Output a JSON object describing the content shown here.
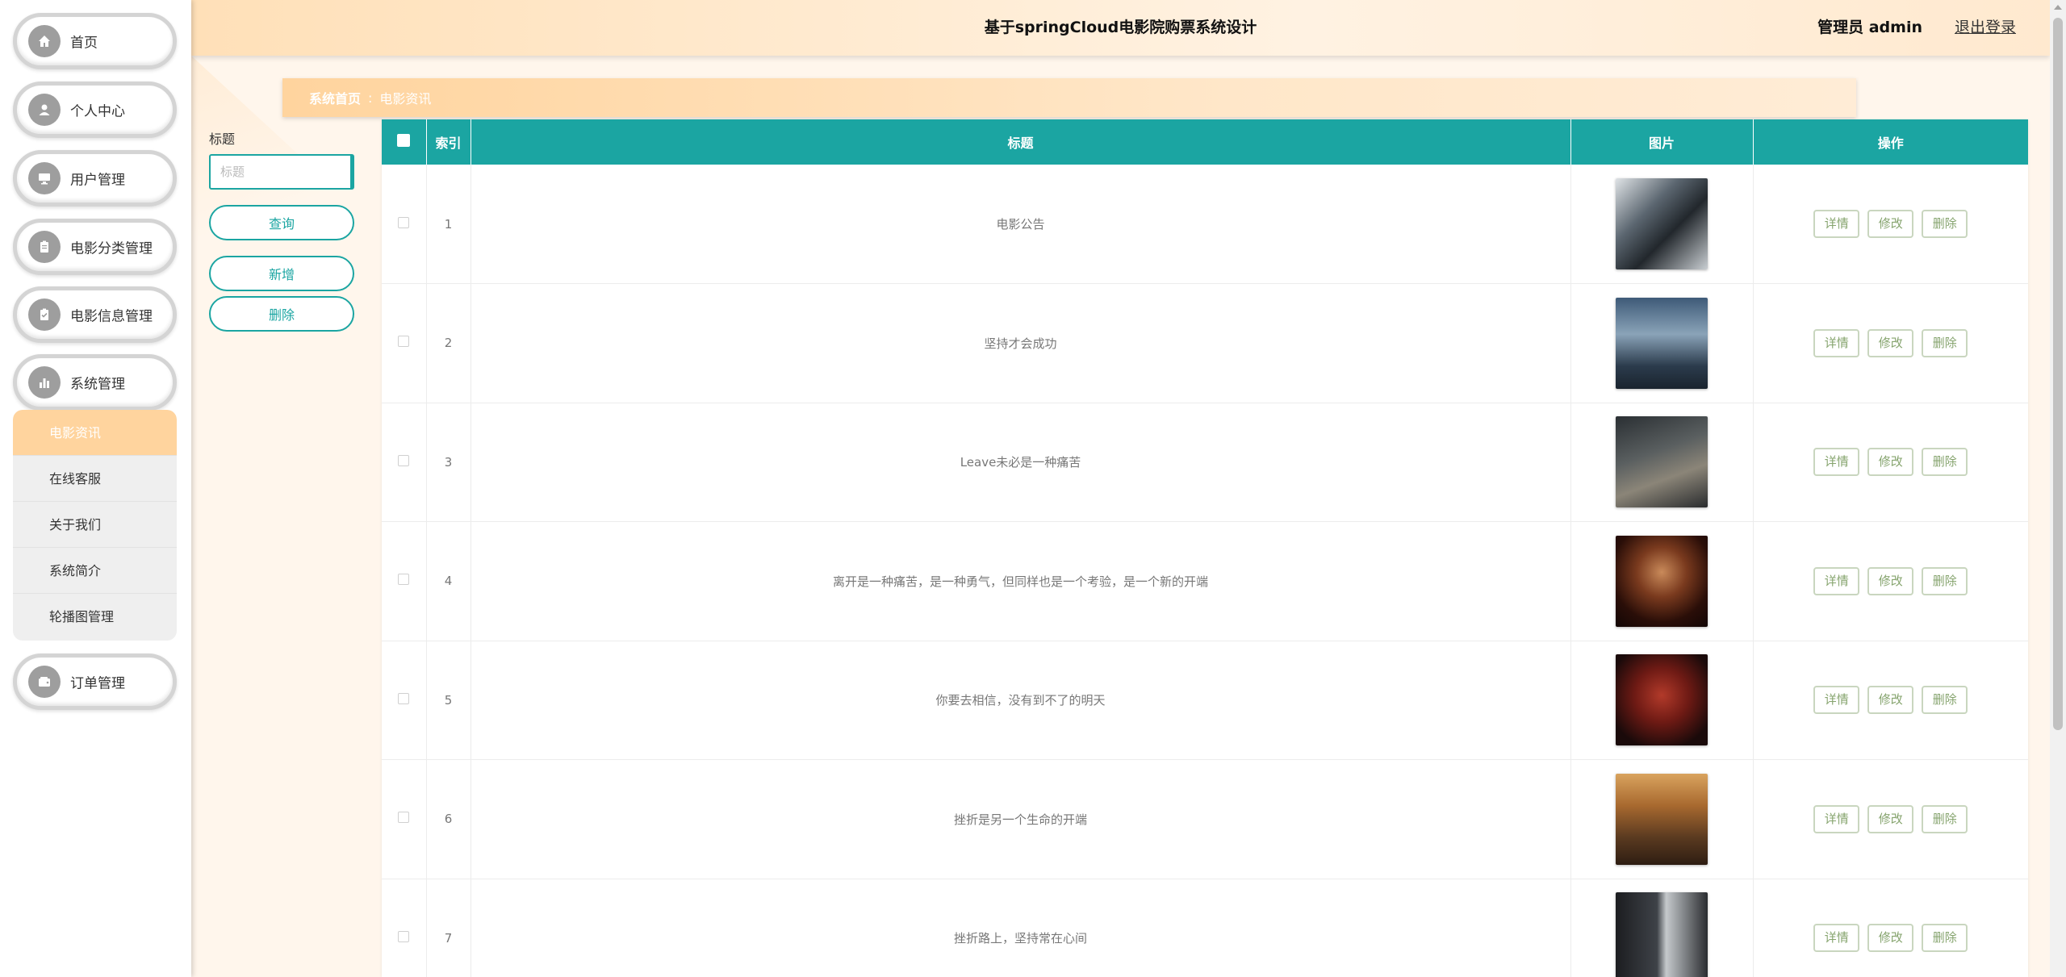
{
  "header": {
    "title": "基于springCloud电影院购票系统设计",
    "user": "管理员 admin",
    "logout": "退出登录"
  },
  "sidebar": {
    "menu": [
      {
        "label": "首页",
        "icon": "home-icon"
      },
      {
        "label": "个人中心",
        "icon": "person-icon"
      },
      {
        "label": "用户管理",
        "icon": "monitor-icon"
      },
      {
        "label": "电影分类管理",
        "icon": "clipboard-icon"
      },
      {
        "label": "电影信息管理",
        "icon": "clipboard-check-icon"
      },
      {
        "label": "系统管理",
        "icon": "bar-chart-icon"
      }
    ],
    "submenu": [
      "电影资讯",
      "在线客服",
      "关于我们",
      "系统简介",
      "轮播图管理"
    ],
    "submenu_active": 0,
    "last_menu": {
      "label": "订单管理",
      "icon": "wallet-icon"
    }
  },
  "breadcrumb": {
    "home": "系统首页",
    "separator": ":",
    "current": "电影资讯"
  },
  "filter": {
    "label": "标题",
    "placeholder": "标题",
    "query_button": "查询",
    "add_button": "新增",
    "delete_button": "删除"
  },
  "table": {
    "headers": {
      "index": "索引",
      "title": "标题",
      "image": "图片",
      "ops": "操作"
    },
    "ops": {
      "detail": "详情",
      "edit": "修改",
      "delete": "删除"
    },
    "rows": [
      {
        "index": "1",
        "title": "电影公告"
      },
      {
        "index": "2",
        "title": "坚持才会成功"
      },
      {
        "index": "3",
        "title": "Leave未必是一种痛苦"
      },
      {
        "index": "4",
        "title": "离开是一种痛苦，是一种勇气，但同样也是一个考验，是一个新的开端"
      },
      {
        "index": "5",
        "title": "你要去相信，没有到不了的明天"
      },
      {
        "index": "6",
        "title": "挫折是另一个生命的开端"
      },
      {
        "index": "7",
        "title": "挫折路上，坚持常在心间"
      }
    ]
  },
  "colors": {
    "accent": "#1ba5a2",
    "header_bg": "#ffe0b8",
    "active_submenu": "#ffd49e",
    "op_button_text": "#86a46e"
  }
}
